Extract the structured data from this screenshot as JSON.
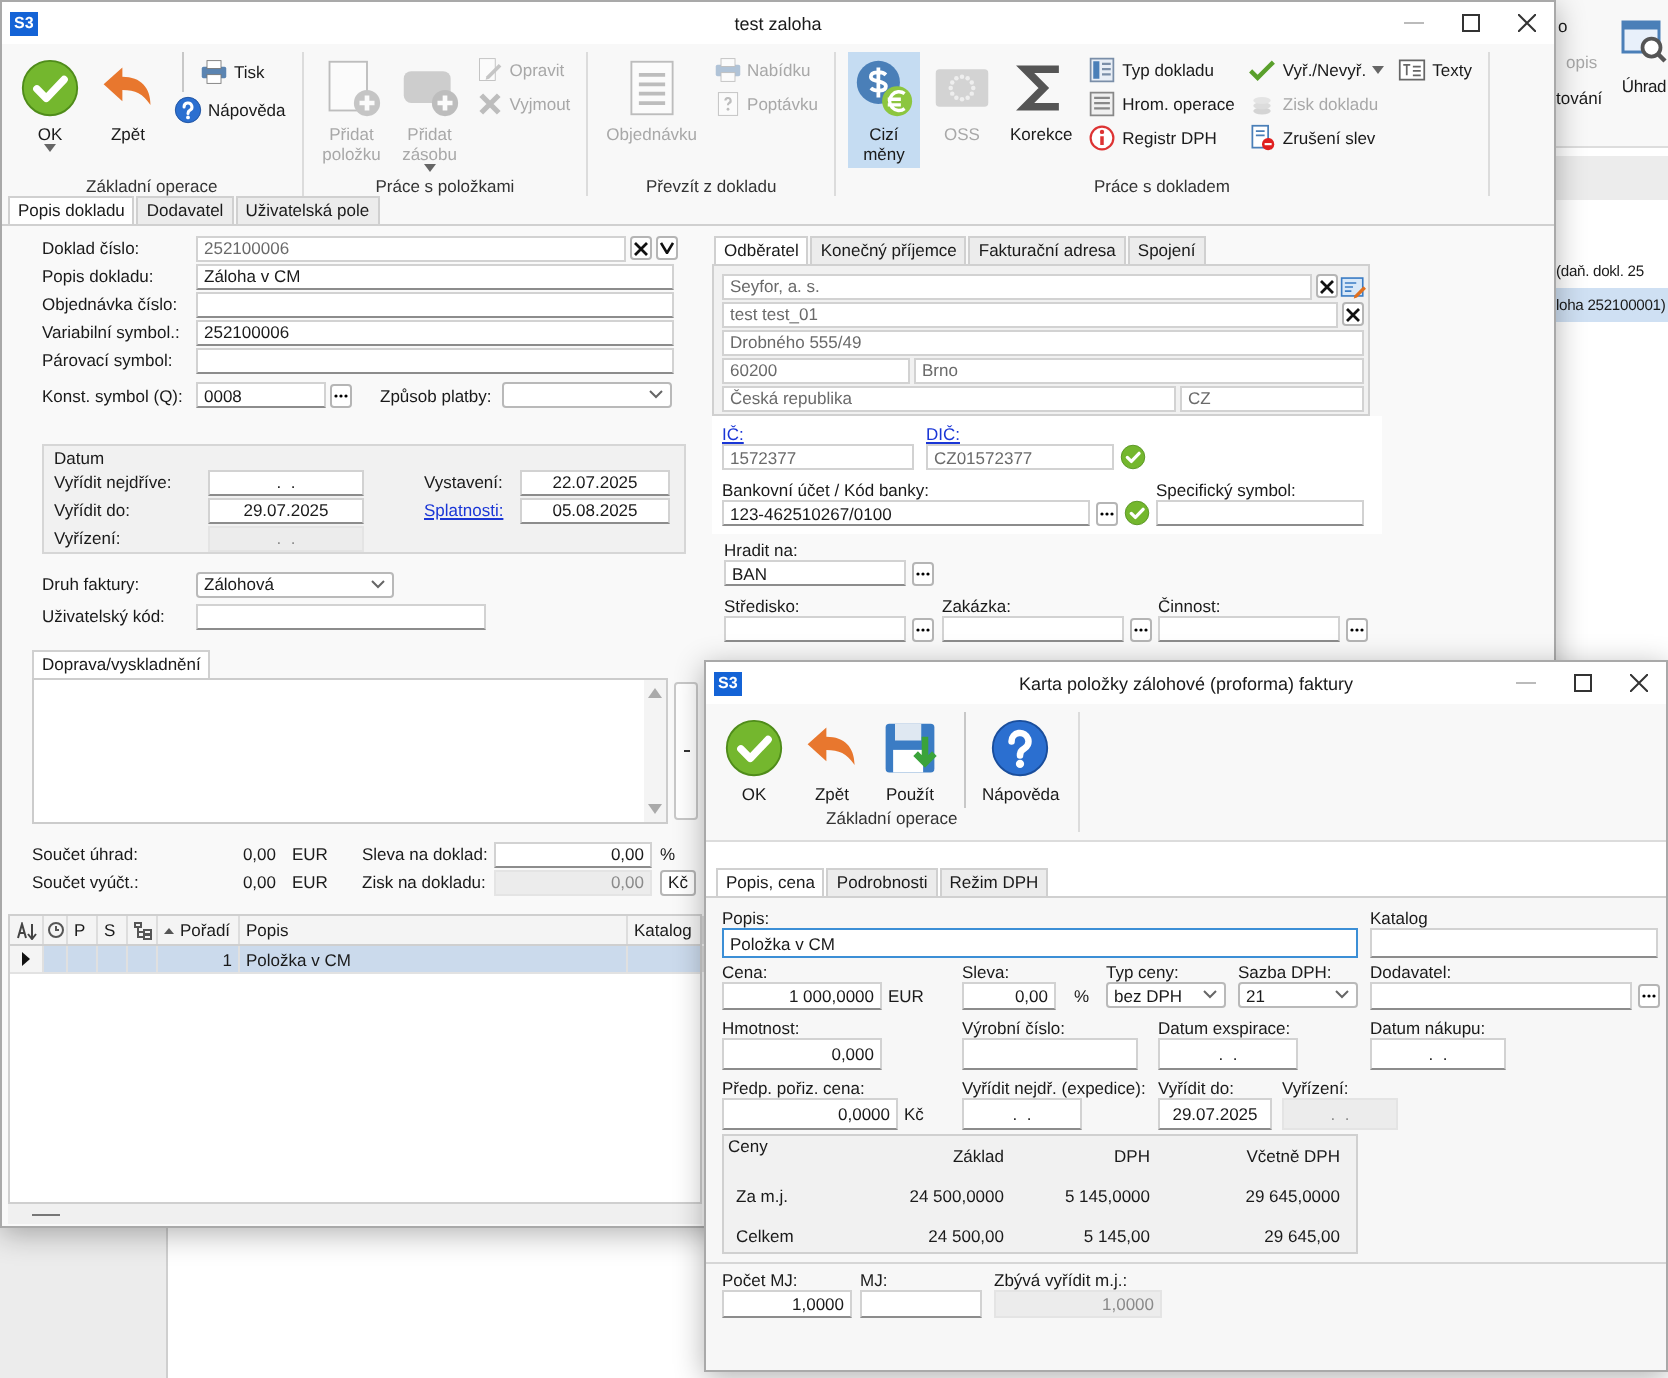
{
  "background_window": {
    "ribbon_labels": [
      {
        "label": "o",
        "disabled": false
      },
      {
        "label": "opis",
        "disabled": true
      },
      {
        "label": "tování",
        "disabled": false
      }
    ],
    "uhrady_button": "Úhrad",
    "rows": [
      {
        "text": "(daň. dokl. 25",
        "selected": false
      },
      {
        "text": "loha 252100001)",
        "selected": true
      }
    ]
  },
  "main_window": {
    "logo": "S3",
    "title": "test zaloha",
    "ribbon": [
      {
        "label": "Základní operace",
        "items": [
          {
            "label": "OK",
            "kind": "large",
            "disabled": false,
            "on": false,
            "dropdown": true,
            "separator_before": false
          },
          {
            "label": "Zpět",
            "kind": "large",
            "disabled": false,
            "on": false,
            "dropdown": false,
            "separator_before": false
          },
          {
            "label": "Tisk",
            "kind": "small",
            "disabled": false,
            "on": false,
            "dropdown": false,
            "separator_before": true
          },
          {
            "label": "Nápověda",
            "kind": "small",
            "disabled": false,
            "on": false,
            "dropdown": false,
            "separator_before": false
          }
        ]
      },
      {
        "label": "Práce s položkami",
        "items": [
          {
            "label": "Přidat položku",
            "kind": "large",
            "disabled": true,
            "on": false,
            "dropdown": false,
            "separator_before": false
          },
          {
            "label": "Přidat zásobu",
            "kind": "large",
            "disabled": true,
            "on": false,
            "dropdown": true,
            "separator_before": false
          },
          {
            "label": "Opravit",
            "kind": "small",
            "disabled": true,
            "on": false,
            "dropdown": false,
            "separator_before": false
          },
          {
            "label": "Vyjmout",
            "kind": "small",
            "disabled": true,
            "on": false,
            "dropdown": false,
            "separator_before": false
          }
        ]
      },
      {
        "label": "Převzít z dokladu",
        "items": [
          {
            "label": "Objednávku",
            "kind": "large",
            "disabled": true,
            "on": false,
            "dropdown": false,
            "separator_before": false
          },
          {
            "label": "Nabídku",
            "kind": "small",
            "disabled": true,
            "on": false,
            "dropdown": false,
            "separator_before": false
          },
          {
            "label": "Poptávku",
            "kind": "small",
            "disabled": true,
            "on": false,
            "dropdown": false,
            "separator_before": false
          }
        ]
      },
      {
        "label": "Práce s dokladem",
        "items": [
          {
            "label": "Cizí měny",
            "kind": "large",
            "disabled": false,
            "on": true,
            "dropdown": false,
            "separator_before": false
          },
          {
            "label": "OSS",
            "kind": "large",
            "disabled": true,
            "on": false,
            "dropdown": false,
            "separator_before": false
          },
          {
            "label": "Korekce",
            "kind": "large",
            "disabled": false,
            "on": false,
            "dropdown": false,
            "separator_before": false
          },
          {
            "label": "Typ dokladu",
            "kind": "small",
            "disabled": false,
            "on": false,
            "dropdown": false,
            "separator_before": false
          },
          {
            "label": "Hrom. operace",
            "kind": "small",
            "disabled": false,
            "on": false,
            "dropdown": false,
            "separator_before": false
          },
          {
            "label": "Registr DPH",
            "kind": "small",
            "disabled": false,
            "on": false,
            "dropdown": false,
            "separator_before": false
          },
          {
            "label": "Vyř./Nevyř.",
            "kind": "small",
            "disabled": false,
            "on": false,
            "dropdown": true,
            "separator_before": false
          },
          {
            "label": "Zisk dokladu",
            "kind": "small",
            "disabled": true,
            "on": false,
            "dropdown": false,
            "separator_before": false
          },
          {
            "label": "Zrušení slev",
            "kind": "small",
            "disabled": false,
            "on": false,
            "dropdown": false,
            "separator_before": false
          },
          {
            "label": "Texty",
            "kind": "small",
            "disabled": false,
            "on": false,
            "dropdown": false,
            "separator_before": false
          }
        ]
      }
    ],
    "tabs": [
      {
        "label": "Popis dokladu",
        "selected": true
      },
      {
        "label": "Dodavatel",
        "selected": false
      },
      {
        "label": "Uživatelská pole",
        "selected": false
      }
    ],
    "header_form": {
      "doklad_cislo": {
        "label": "Doklad číslo:",
        "value": "252100006"
      },
      "popis_dokladu": {
        "label": "Popis dokladu:",
        "value": "Záloha v CM"
      },
      "objednavka_cislo": {
        "label": "Objednávka číslo:"
      },
      "variabilni_symbol": {
        "label": "Variabilní symbol.:",
        "value": "252100006"
      },
      "parovaci_symbol": {
        "label": "Párovací symbol:"
      },
      "konst_symbol": {
        "label": "Konst. symbol (Q):",
        "value": "0008"
      },
      "zpusob_platby": {
        "label": "Způsob platby:"
      },
      "datum": {
        "title": "Datum",
        "fields": [
          {
            "label": "Vyřídit nejdříve:",
            "value": ".  .",
            "disabled": false,
            "kind": "plain"
          },
          {
            "label": "Vyřídit do:",
            "value": "29.07.2025",
            "disabled": false,
            "kind": "plain"
          },
          {
            "label": "Vyřízení:",
            "value": ".  .",
            "disabled": true,
            "kind": "plain"
          },
          {
            "label": "Vystavení:",
            "value": "22.07.2025",
            "disabled": false,
            "kind": "plain"
          },
          {
            "label": "Splatnosti:",
            "value": "05.08.2025",
            "disabled": false,
            "kind": "link"
          }
        ]
      },
      "druh_faktury": {
        "label": "Druh faktury:",
        "value": "Zálohová"
      },
      "uzivatelsky_kod": {
        "label": "Uživatelský kód:"
      }
    },
    "transport_tab": "Doprava/vyskladnění",
    "totals": {
      "soucet_uhrad": {
        "label": "Součet úhrad:",
        "value": "0,00",
        "unit": "EUR"
      },
      "soucet_vyuct": {
        "label": "Součet vyúčt.:",
        "value": "0,00",
        "unit": "EUR"
      },
      "sleva": {
        "label": "Sleva na doklad:",
        "value": "0,00",
        "unit": "%"
      },
      "zisk": {
        "label": "Zisk na dokladu:",
        "value": "0,00",
        "unit": "Kč"
      }
    },
    "partner": {
      "tabs": [
        {
          "label": "Odběratel",
          "selected": true
        },
        {
          "label": "Konečný příjemce",
          "selected": false
        },
        {
          "label": "Fakturační adresa",
          "selected": false
        },
        {
          "label": "Spojení",
          "selected": false
        }
      ],
      "name": "Seyfor, a. s.",
      "contact": "test test_01",
      "street": "Drobného 555/49",
      "zip": "60200",
      "city": "Brno",
      "country": "Česká republika",
      "country_code": "CZ",
      "ic": {
        "label": "IČ:",
        "value": "1572377"
      },
      "dic": {
        "label": "DIČ:",
        "value": "CZ01572377",
        "valid": true
      },
      "bank": {
        "label": "Bankovní účet / Kód banky:",
        "value": "123-462510267/0100",
        "valid": true
      },
      "specificky_symbol": {
        "label": "Specifický symbol:"
      },
      "hradit_na": {
        "label": "Hradit na:",
        "value": "BAN"
      },
      "stredisko": {
        "label": "Středisko:"
      },
      "zakazka": {
        "label": "Zakázka:"
      },
      "cinnost": {
        "label": "Činnost:"
      }
    },
    "items_table": {
      "columns": [
        "P",
        "S",
        "Pořadí",
        "Popis",
        "Katalog"
      ],
      "rows": [
        {
          "poradi": "1",
          "popis": "Položka v CM",
          "selected": true
        }
      ]
    }
  },
  "item_dialog": {
    "logo": "S3",
    "title": "Karta položky zálohové (proforma) faktury",
    "ribbon": [
      {
        "label": "Základní operace",
        "items": [
          {
            "label": "OK",
            "kind": "large",
            "disabled": false,
            "on": false,
            "dropdown": false,
            "separator_before": false
          },
          {
            "label": "Zpět",
            "kind": "large",
            "disabled": false,
            "on": false,
            "dropdown": false,
            "separator_before": false
          },
          {
            "label": "Použít",
            "kind": "large",
            "disabled": false,
            "on": false,
            "dropdown": false,
            "separator_before": false
          },
          {
            "label": "Nápověda",
            "kind": "large",
            "disabled": false,
            "on": false,
            "dropdown": false,
            "separator_before": true
          }
        ]
      }
    ],
    "tabs": [
      {
        "label": "Popis, cena",
        "selected": true
      },
      {
        "label": "Podrobnosti",
        "selected": false
      },
      {
        "label": "Režim DPH",
        "selected": false
      }
    ],
    "fields": {
      "popis": {
        "label": "Popis:",
        "value": "Položka v CM",
        "focused": true
      },
      "katalog": {
        "label": "Katalog"
      },
      "cena": {
        "label": "Cena:",
        "value": "1 000,0000",
        "unit": "EUR"
      },
      "sleva": {
        "label": "Sleva:",
        "value": "0,00",
        "unit": "%"
      },
      "typ_ceny": {
        "label": "Typ ceny:",
        "value": "bez DPH"
      },
      "sazba_dph": {
        "label": "Sazba DPH:",
        "value": "21"
      },
      "dodavatel": {
        "label": "Dodavatel:"
      },
      "hmotnost": {
        "label": "Hmotnost:",
        "value": "0,000"
      },
      "vyrobni_cislo": {
        "label": "Výrobní číslo:"
      },
      "datum_exspirace": {
        "label": "Datum exspirace:",
        "value": ".  ."
      },
      "datum_nakupu": {
        "label": "Datum nákupu:",
        "value": ".  ."
      },
      "predp_poriz_cena": {
        "label": "Předp. pořiz. cena:",
        "value": "0,0000",
        "unit": "Kč"
      },
      "vyridit_nejdr": {
        "label": "Vyřídit nejdř. (expedice):",
        "value": ".  ."
      },
      "vyridit_do": {
        "label": "Vyřídit do:",
        "value": "29.07.2025"
      },
      "vyrizeni": {
        "label": "Vyřízení:",
        "value": ".  .",
        "disabled": true
      },
      "pocet_mj": {
        "label": "Počet MJ:",
        "value": "1,0000"
      },
      "mj": {
        "label": "MJ:"
      },
      "zbyva": {
        "label": "Zbývá vyřídit m.j.:",
        "value": "1,0000",
        "disabled": true
      }
    },
    "prices": {
      "title": "Ceny",
      "columns": [
        "Základ",
        "DPH",
        "Včetně DPH"
      ],
      "rows": [
        {
          "label": "Za m.j.",
          "values": [
            "24 500,0000",
            "5 145,0000",
            "29 645,0000"
          ]
        },
        {
          "label": "Celkem",
          "values": [
            "24 500,00",
            "5 145,00",
            "29 645,00"
          ]
        }
      ]
    }
  }
}
